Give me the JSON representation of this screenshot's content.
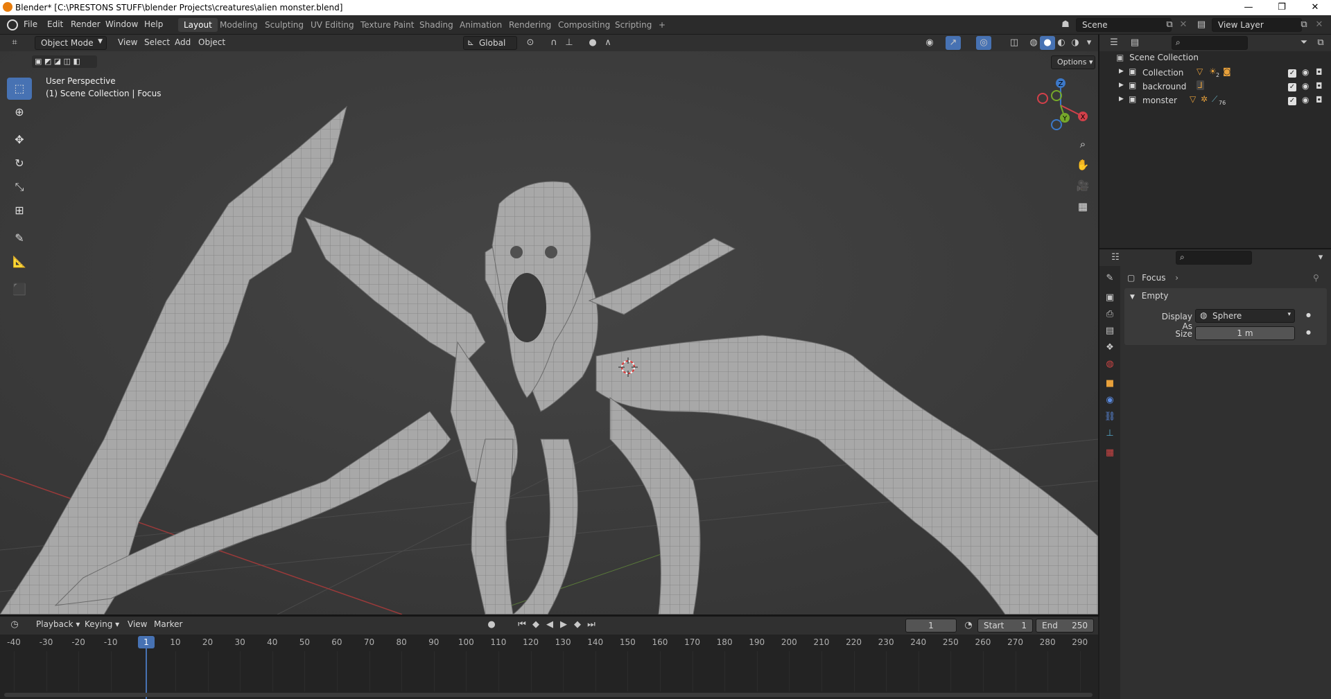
{
  "window": {
    "title": "Blender* [C:\\PRESTONS STUFF\\blender Projects\\creatures\\alien monster.blend]",
    "controls": [
      "—",
      "❐",
      "✕"
    ]
  },
  "menus": [
    "File",
    "Edit",
    "Render",
    "Window",
    "Help"
  ],
  "workspaces": [
    "Layout",
    "Modeling",
    "Sculpting",
    "UV Editing",
    "Texture Paint",
    "Shading",
    "Animation",
    "Rendering",
    "Compositing",
    "Scripting",
    "+"
  ],
  "scene": {
    "name": "Scene",
    "view_layer": "View Layer"
  },
  "viewport_header": {
    "mode": "Object Mode",
    "menus": [
      "View",
      "Select",
      "Add",
      "Object"
    ],
    "orientation": "Global",
    "options": "Options"
  },
  "viewport": {
    "overlay_line1": "User Perspective",
    "overlay_line2": "(1) Scene Collection | Focus",
    "gizmo": {
      "z": "Z",
      "y": "Y",
      "x": "X"
    },
    "colors": {
      "x_axis": "#d3404a",
      "y_axis": "#76a82a",
      "z_axis": "#3c78c8",
      "active_tool": "#4772b3"
    }
  },
  "outliner": {
    "root": "Scene Collection",
    "items": [
      {
        "label": "Collection",
        "badge": "2"
      },
      {
        "label": "backround",
        "badge": ""
      },
      {
        "label": "monster",
        "badge": "76"
      }
    ]
  },
  "properties": {
    "object_name": "Focus",
    "panel": "Empty",
    "display_as_label": "Display As",
    "display_as_value": "Sphere",
    "size_label": "Size",
    "size_value": "1 m"
  },
  "timeline": {
    "menus": [
      "Playback",
      "Keying",
      "View",
      "Marker"
    ],
    "current_frame": "1",
    "start_label": "Start",
    "start_value": "1",
    "end_label": "End",
    "end_value": "250",
    "ticks": [
      "-40",
      "-30",
      "-20",
      "-10",
      "1",
      "10",
      "20",
      "30",
      "40",
      "50",
      "60",
      "70",
      "80",
      "90",
      "100",
      "110",
      "120",
      "130",
      "140",
      "150",
      "160",
      "170",
      "180",
      "190",
      "200",
      "210",
      "220",
      "230",
      "240",
      "250",
      "260",
      "270",
      "280",
      "290"
    ]
  }
}
